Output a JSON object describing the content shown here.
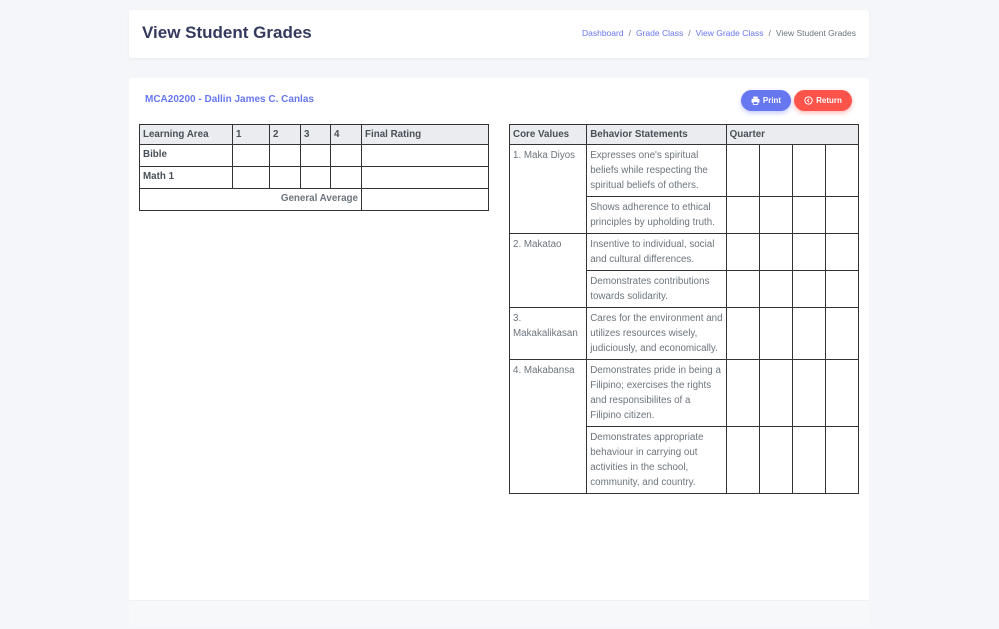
{
  "header": {
    "title": "View Student Grades",
    "breadcrumb": [
      "Dashboard",
      "Grade Class",
      "View Grade Class",
      "View Student Grades"
    ]
  },
  "student": {
    "name": "MCA20200 - Dallin James C. Canlas"
  },
  "buttons": {
    "print": "Print",
    "return": "Return"
  },
  "grades": {
    "headers": [
      "Learning Area",
      "1",
      "2",
      "3",
      "4",
      "Final Rating"
    ],
    "rows": [
      {
        "subject": "Bible"
      },
      {
        "subject": "Math 1"
      }
    ],
    "general_average_label": "General Average"
  },
  "values": {
    "headers": [
      "Core Values",
      "Behavior Statements",
      "Quarter"
    ],
    "groups": [
      {
        "core": "1. Maka Diyos",
        "statements": [
          "Expresses one's spiritual beliefs while respecting the spiritual beliefs of others.",
          "Shows adherence to ethical principles by upholding truth."
        ]
      },
      {
        "core": "2. Makatao",
        "statements": [
          "Insentive to individual, social and cultural differences.",
          "Demonstrates contributions towards solidarity."
        ]
      },
      {
        "core": "3. Makakalikasan",
        "statements": [
          "Cares for the environment and utilizes resources wisely, judiciously, and economically."
        ]
      },
      {
        "core": "4. Makabansa",
        "statements": [
          "Demonstrates pride in being a Filipino; exercises the rights and responsibilites of a Filipino citizen.",
          "Demonstrates appropriate behaviour in carrying out activities in the school, community, and country."
        ]
      }
    ]
  },
  "colors": {
    "primary": "#6777ef",
    "danger": "#fc544b",
    "background": "#f4f6f9"
  }
}
